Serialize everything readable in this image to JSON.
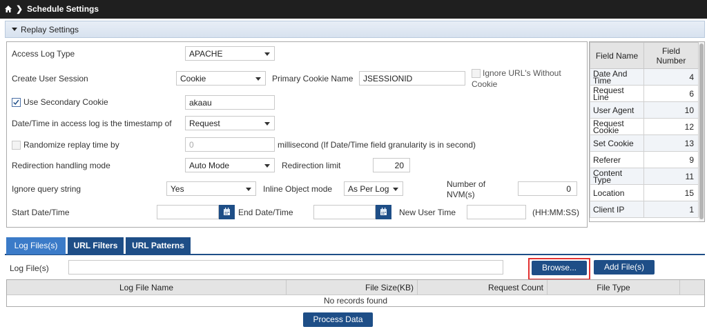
{
  "breadcrumb": {
    "title": "Schedule Settings"
  },
  "section": {
    "title": "Replay Settings"
  },
  "form": {
    "access_log_type_label": "Access Log Type",
    "access_log_type_value": "APACHE",
    "create_user_session_label": "Create User Session",
    "create_user_session_value": "Cookie",
    "primary_cookie_name_label": "Primary Cookie Name",
    "primary_cookie_name_value": "JSESSIONID",
    "ignore_urls_line1": "Ignore URL's Without",
    "ignore_urls_line2": "Cookie",
    "use_secondary_cookie_label": "Use Secondary Cookie",
    "use_secondary_cookie_value": "akaau",
    "timestamp_label": "Date/Time in access log is the timestamp of",
    "timestamp_value": "Request",
    "randomize_label": "Randomize replay time by",
    "randomize_value": "0",
    "millisecond_label": "millisecond (If Date/Time field granularity is in second)",
    "redirection_mode_label": "Redirection handling mode",
    "redirection_mode_value": "Auto Mode",
    "redirection_limit_label": "Redirection limit",
    "redirection_limit_value": "20",
    "ignore_query_label": "Ignore query string",
    "ignore_query_value": "Yes",
    "inline_object_label": "Inline Object mode",
    "inline_object_value": "As Per Log",
    "nvm_label_line1": "Number of",
    "nvm_label_line2": "NVM(s)",
    "nvm_value": "0",
    "start_date_label": "Start Date/Time",
    "end_date_label": "End Date/Time",
    "new_user_time_label": "New User Time",
    "time_format_label": "(HH:MM:SS)"
  },
  "field_table": {
    "headers": {
      "name": "Field Name",
      "number_line1": "Field",
      "number_line2": "Number"
    },
    "rows": [
      {
        "name_line1": "Date And",
        "name_line2": "Time",
        "number": "4"
      },
      {
        "name_line1": "Request Line",
        "name_line2": "",
        "number": "6"
      },
      {
        "name_line1": "User Agent",
        "name_line2": "",
        "number": "10"
      },
      {
        "name_line1": "Request",
        "name_line2": "Cookie",
        "number": "12"
      },
      {
        "name_line1": "Set Cookie",
        "name_line2": "",
        "number": "13"
      },
      {
        "name_line1": "Referer",
        "name_line2": "",
        "number": "9"
      },
      {
        "name_line1": "Content",
        "name_line2": "Type",
        "number": "11"
      },
      {
        "name_line1": "Location",
        "name_line2": "",
        "number": "15"
      },
      {
        "name_line1": "Client IP",
        "name_line2": "",
        "number": "1"
      }
    ]
  },
  "tabs": [
    {
      "label": "Log Files(s)"
    },
    {
      "label": "URL Filters"
    },
    {
      "label": "URL Patterns"
    }
  ],
  "log_files": {
    "label": "Log File(s)",
    "browse_label": "Browse...",
    "add_files_label": "Add File(s)",
    "columns": [
      "Log File Name",
      "File Size(KB)",
      "Request Count",
      "File Type"
    ],
    "empty_text": "No records found",
    "process_label": "Process Data"
  },
  "colors": {
    "topbar": "#1f1f1f",
    "primary": "#1e4e87",
    "active_tab": "#3b7bc8",
    "highlight": "#e23030"
  }
}
